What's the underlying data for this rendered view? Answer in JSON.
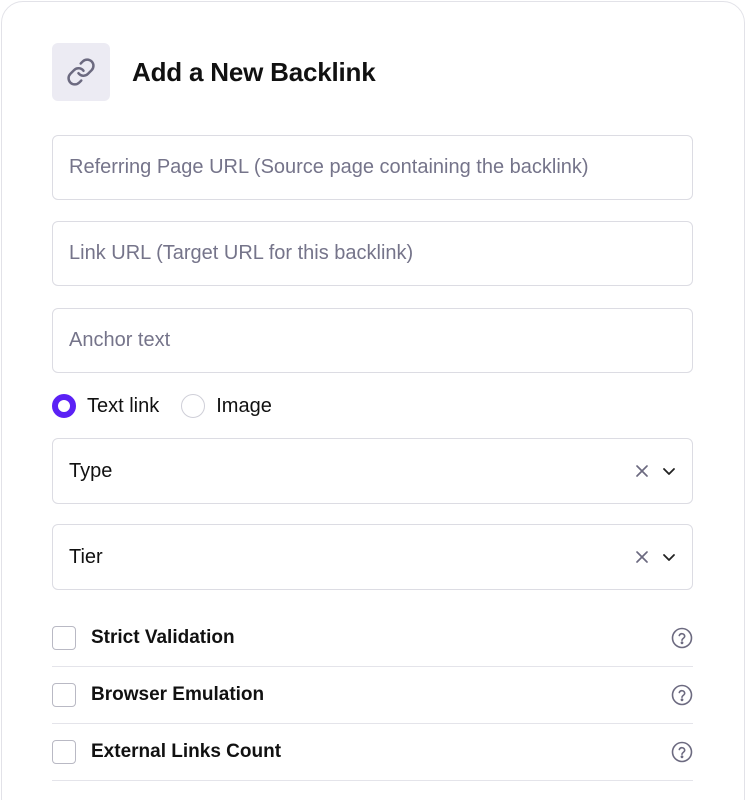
{
  "header": {
    "icon": "link-icon",
    "title": "Add a New Backlink"
  },
  "form": {
    "referring_page_url": {
      "placeholder": "Referring Page URL (Source page containing the backlink)",
      "value": ""
    },
    "link_url": {
      "placeholder": "Link URL (Target URL for this backlink)",
      "value": ""
    },
    "anchor_text": {
      "placeholder": "Anchor text",
      "value": ""
    },
    "link_format": {
      "options": [
        {
          "label": "Text link",
          "checked": true
        },
        {
          "label": "Image",
          "checked": false
        }
      ]
    },
    "type_select": {
      "value": "Type",
      "clear_icon": "close-icon",
      "chevron_icon": "chevron-down-icon"
    },
    "tier_select": {
      "value": "Tier",
      "clear_icon": "close-icon",
      "chevron_icon": "chevron-down-icon"
    },
    "options": [
      {
        "label": "Strict Validation",
        "checked": false,
        "help_icon": "help-circle-icon"
      },
      {
        "label": "Browser Emulation",
        "checked": false,
        "help_icon": "help-circle-icon"
      },
      {
        "label": "External Links Count",
        "checked": false,
        "help_icon": "help-circle-icon"
      }
    ]
  },
  "colors": {
    "accent": "#5b21f5",
    "border": "#dcdce3",
    "placeholder": "#75748a",
    "icon_bg": "#ecebf3"
  }
}
